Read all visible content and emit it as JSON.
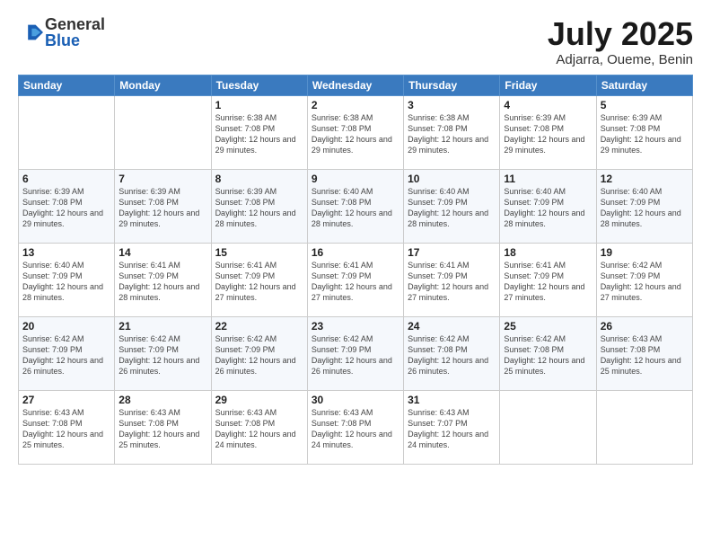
{
  "logo": {
    "general": "General",
    "blue": "Blue"
  },
  "title": "July 2025",
  "location": "Adjarra, Oueme, Benin",
  "days_header": [
    "Sunday",
    "Monday",
    "Tuesday",
    "Wednesday",
    "Thursday",
    "Friday",
    "Saturday"
  ],
  "weeks": [
    [
      {
        "day": "",
        "info": ""
      },
      {
        "day": "",
        "info": ""
      },
      {
        "day": "1",
        "info": "Sunrise: 6:38 AM\nSunset: 7:08 PM\nDaylight: 12 hours and 29 minutes."
      },
      {
        "day": "2",
        "info": "Sunrise: 6:38 AM\nSunset: 7:08 PM\nDaylight: 12 hours and 29 minutes."
      },
      {
        "day": "3",
        "info": "Sunrise: 6:38 AM\nSunset: 7:08 PM\nDaylight: 12 hours and 29 minutes."
      },
      {
        "day": "4",
        "info": "Sunrise: 6:39 AM\nSunset: 7:08 PM\nDaylight: 12 hours and 29 minutes."
      },
      {
        "day": "5",
        "info": "Sunrise: 6:39 AM\nSunset: 7:08 PM\nDaylight: 12 hours and 29 minutes."
      }
    ],
    [
      {
        "day": "6",
        "info": "Sunrise: 6:39 AM\nSunset: 7:08 PM\nDaylight: 12 hours and 29 minutes."
      },
      {
        "day": "7",
        "info": "Sunrise: 6:39 AM\nSunset: 7:08 PM\nDaylight: 12 hours and 29 minutes."
      },
      {
        "day": "8",
        "info": "Sunrise: 6:39 AM\nSunset: 7:08 PM\nDaylight: 12 hours and 28 minutes."
      },
      {
        "day": "9",
        "info": "Sunrise: 6:40 AM\nSunset: 7:08 PM\nDaylight: 12 hours and 28 minutes."
      },
      {
        "day": "10",
        "info": "Sunrise: 6:40 AM\nSunset: 7:09 PM\nDaylight: 12 hours and 28 minutes."
      },
      {
        "day": "11",
        "info": "Sunrise: 6:40 AM\nSunset: 7:09 PM\nDaylight: 12 hours and 28 minutes."
      },
      {
        "day": "12",
        "info": "Sunrise: 6:40 AM\nSunset: 7:09 PM\nDaylight: 12 hours and 28 minutes."
      }
    ],
    [
      {
        "day": "13",
        "info": "Sunrise: 6:40 AM\nSunset: 7:09 PM\nDaylight: 12 hours and 28 minutes."
      },
      {
        "day": "14",
        "info": "Sunrise: 6:41 AM\nSunset: 7:09 PM\nDaylight: 12 hours and 28 minutes."
      },
      {
        "day": "15",
        "info": "Sunrise: 6:41 AM\nSunset: 7:09 PM\nDaylight: 12 hours and 27 minutes."
      },
      {
        "day": "16",
        "info": "Sunrise: 6:41 AM\nSunset: 7:09 PM\nDaylight: 12 hours and 27 minutes."
      },
      {
        "day": "17",
        "info": "Sunrise: 6:41 AM\nSunset: 7:09 PM\nDaylight: 12 hours and 27 minutes."
      },
      {
        "day": "18",
        "info": "Sunrise: 6:41 AM\nSunset: 7:09 PM\nDaylight: 12 hours and 27 minutes."
      },
      {
        "day": "19",
        "info": "Sunrise: 6:42 AM\nSunset: 7:09 PM\nDaylight: 12 hours and 27 minutes."
      }
    ],
    [
      {
        "day": "20",
        "info": "Sunrise: 6:42 AM\nSunset: 7:09 PM\nDaylight: 12 hours and 26 minutes."
      },
      {
        "day": "21",
        "info": "Sunrise: 6:42 AM\nSunset: 7:09 PM\nDaylight: 12 hours and 26 minutes."
      },
      {
        "day": "22",
        "info": "Sunrise: 6:42 AM\nSunset: 7:09 PM\nDaylight: 12 hours and 26 minutes."
      },
      {
        "day": "23",
        "info": "Sunrise: 6:42 AM\nSunset: 7:09 PM\nDaylight: 12 hours and 26 minutes."
      },
      {
        "day": "24",
        "info": "Sunrise: 6:42 AM\nSunset: 7:08 PM\nDaylight: 12 hours and 26 minutes."
      },
      {
        "day": "25",
        "info": "Sunrise: 6:42 AM\nSunset: 7:08 PM\nDaylight: 12 hours and 25 minutes."
      },
      {
        "day": "26",
        "info": "Sunrise: 6:43 AM\nSunset: 7:08 PM\nDaylight: 12 hours and 25 minutes."
      }
    ],
    [
      {
        "day": "27",
        "info": "Sunrise: 6:43 AM\nSunset: 7:08 PM\nDaylight: 12 hours and 25 minutes."
      },
      {
        "day": "28",
        "info": "Sunrise: 6:43 AM\nSunset: 7:08 PM\nDaylight: 12 hours and 25 minutes."
      },
      {
        "day": "29",
        "info": "Sunrise: 6:43 AM\nSunset: 7:08 PM\nDaylight: 12 hours and 24 minutes."
      },
      {
        "day": "30",
        "info": "Sunrise: 6:43 AM\nSunset: 7:08 PM\nDaylight: 12 hours and 24 minutes."
      },
      {
        "day": "31",
        "info": "Sunrise: 6:43 AM\nSunset: 7:07 PM\nDaylight: 12 hours and 24 minutes."
      },
      {
        "day": "",
        "info": ""
      },
      {
        "day": "",
        "info": ""
      }
    ]
  ]
}
